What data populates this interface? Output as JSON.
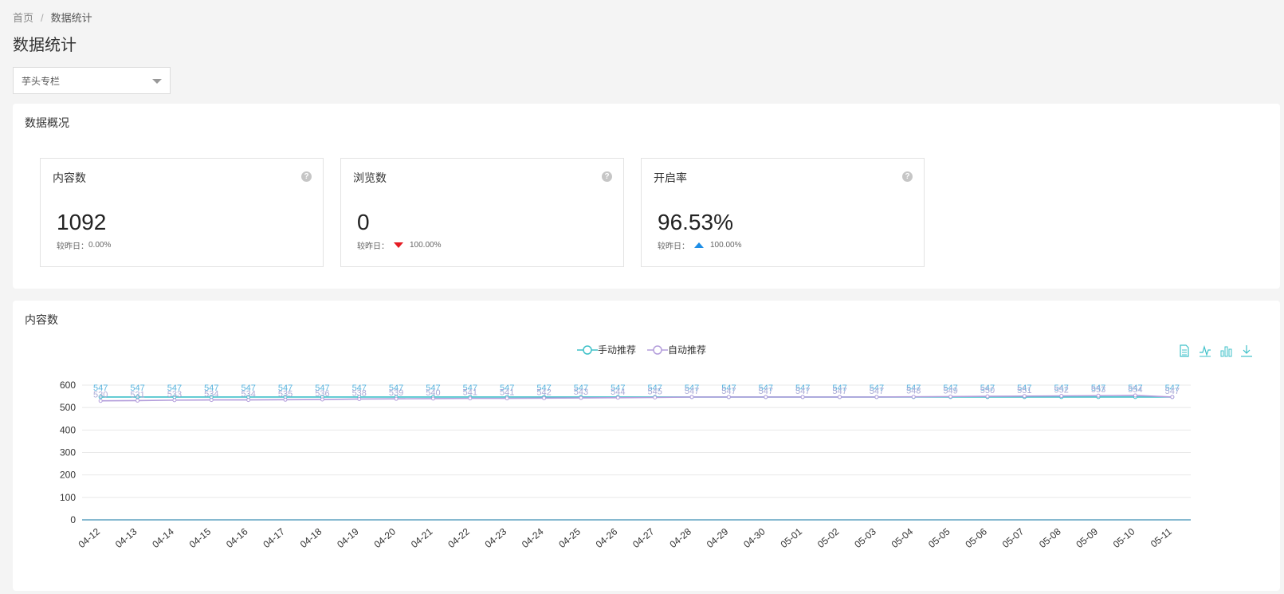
{
  "breadcrumb": {
    "home": "首页",
    "separator": "/",
    "current": "数据统计"
  },
  "page_title": "数据统计",
  "select": {
    "value": "芋头专栏"
  },
  "overview": {
    "title": "数据概况",
    "cards": [
      {
        "label": "内容数",
        "value": "1092",
        "compare_label": "较昨日：",
        "change": "0.00%",
        "trend": "none"
      },
      {
        "label": "浏览数",
        "value": "0",
        "compare_label": "较昨日：",
        "change": "100.00%",
        "trend": "down"
      },
      {
        "label": "开启率",
        "value": "96.53%",
        "compare_label": "较昨日：",
        "change": "100.00%",
        "trend": "up"
      }
    ],
    "help_icon": "question-circle-icon"
  },
  "chart_panel": {
    "title": "内容数",
    "toolbox_icons": [
      "data-view-icon",
      "line-chart-icon",
      "bar-chart-icon",
      "download-icon"
    ]
  },
  "colors": {
    "manual": "#3fc1c9",
    "auto": "#b39ddb",
    "axis": "#3f8fb5",
    "label_manual": "#5ab4de",
    "label_auto": "#a9a9d6"
  },
  "chart_data": {
    "type": "line",
    "x": [
      "04-12",
      "04-13",
      "04-14",
      "04-15",
      "04-16",
      "04-17",
      "04-18",
      "04-19",
      "04-20",
      "04-21",
      "04-22",
      "04-23",
      "04-24",
      "04-25",
      "04-26",
      "04-27",
      "04-28",
      "04-29",
      "04-30",
      "05-01",
      "05-02",
      "05-03",
      "05-04",
      "05-05",
      "05-06",
      "05-07",
      "05-08",
      "05-09",
      "05-10",
      "05-11"
    ],
    "ylim": [
      0,
      600
    ],
    "yticks": [
      0,
      100,
      200,
      300,
      400,
      500,
      600
    ],
    "grid": true,
    "legend": "top-center",
    "series": [
      {
        "name": "手动推荐",
        "values": [
          547,
          547,
          547,
          547,
          547,
          547,
          547,
          547,
          547,
          547,
          547,
          547,
          547,
          547,
          547,
          547,
          547,
          547,
          547,
          547,
          547,
          547,
          547,
          547,
          547,
          547,
          547,
          547,
          547,
          547
        ]
      },
      {
        "name": "自动推荐",
        "values": [
          530,
          531,
          533,
          534,
          534,
          535,
          536,
          538,
          539,
          540,
          541,
          541,
          542,
          543,
          544,
          545,
          547,
          547,
          547,
          547,
          547,
          547,
          548,
          549,
          550,
          551,
          552,
          553,
          554,
          547
        ]
      }
    ]
  }
}
